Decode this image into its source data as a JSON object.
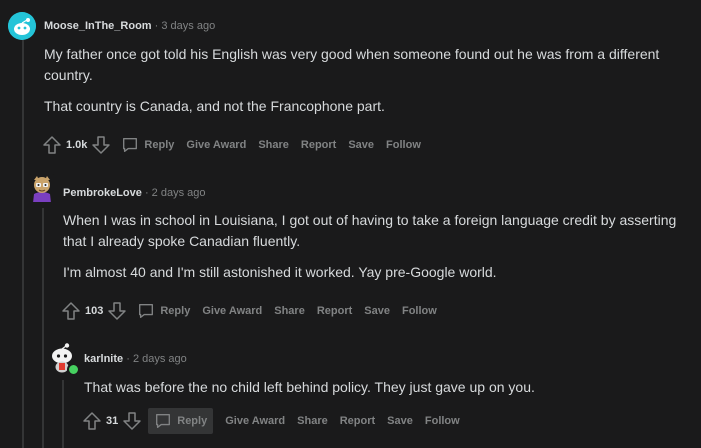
{
  "comments": [
    {
      "author": "Moose_InThe_Room",
      "time": "3 days ago",
      "paragraphs": [
        "My father once got told his English was very good when someone found out he was from a different country.",
        "That country is Canada, and not the Francophone part."
      ],
      "score": "1.0k",
      "actions": [
        "Reply",
        "Give Award",
        "Share",
        "Report",
        "Save",
        "Follow"
      ]
    },
    {
      "author": "PembrokeLove",
      "time": "2 days ago",
      "paragraphs": [
        "When I was in school in Louisiana, I got out of having to take a foreign language credit by asserting that I already spoke Canadian fluently.",
        "I'm almost 40 and I'm still astonished it worked. Yay pre-Google world."
      ],
      "score": "103",
      "actions": [
        "Reply",
        "Give Award",
        "Share",
        "Report",
        "Save",
        "Follow"
      ]
    },
    {
      "author": "karlnite",
      "time": "2 days ago",
      "paragraphs": [
        "That was before the no child left behind policy. They just gave up on you."
      ],
      "score": "31",
      "actions": [
        "Reply",
        "Give Award",
        "Share",
        "Report",
        "Save",
        "Follow"
      ]
    }
  ],
  "separator": "·",
  "colors": {
    "background": "#1a1a1b",
    "text": "#d7dadc",
    "muted": "#818384",
    "thread_line": "#343536",
    "avatar_teal": "#24c4d8",
    "online_green": "#46d160"
  }
}
